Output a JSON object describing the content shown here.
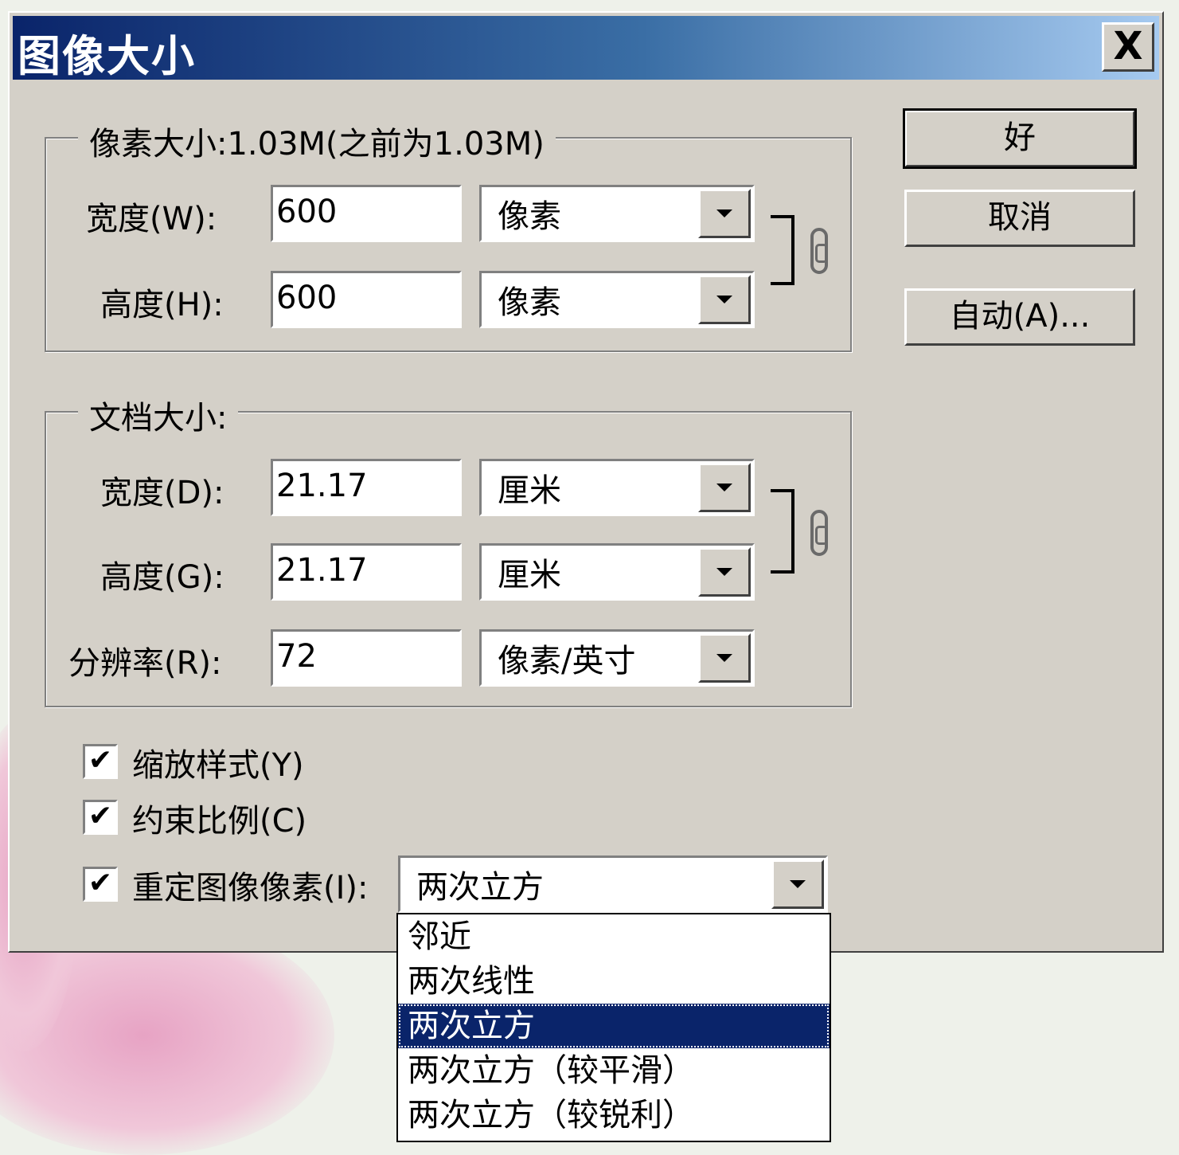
{
  "dialog": {
    "title": "图像大小",
    "close_label": "X"
  },
  "pixel_dimensions": {
    "legend": "像素大小:1.03M(之前为1.03M)",
    "width_label": "宽度(W):",
    "width_value": "600",
    "width_unit": "像素",
    "height_label": "高度(H):",
    "height_value": "600",
    "height_unit": "像素"
  },
  "document_size": {
    "legend": "文档大小:",
    "width_label": "宽度(D):",
    "width_value": "21.17",
    "width_unit": "厘米",
    "height_label": "高度(G):",
    "height_value": "21.17",
    "height_unit": "厘米",
    "resolution_label": "分辨率(R):",
    "resolution_value": "72",
    "resolution_unit": "像素/英寸"
  },
  "buttons": {
    "ok": "好",
    "cancel": "取消",
    "auto": "自动(A)..."
  },
  "options": {
    "scale_styles": {
      "label": "缩放样式(Y)",
      "checked": true
    },
    "constrain_proportions": {
      "label": "约束比例(C)",
      "checked": true
    },
    "resample": {
      "label": "重定图像像素(I):",
      "checked": true
    },
    "check_glyph": "✔"
  },
  "resample_method": {
    "selected": "两次立方",
    "options": [
      "邻近",
      "两次线性",
      "两次立方",
      "两次立方（较平滑）",
      "两次立方（较锐利）"
    ],
    "highlighted_index": 2
  }
}
